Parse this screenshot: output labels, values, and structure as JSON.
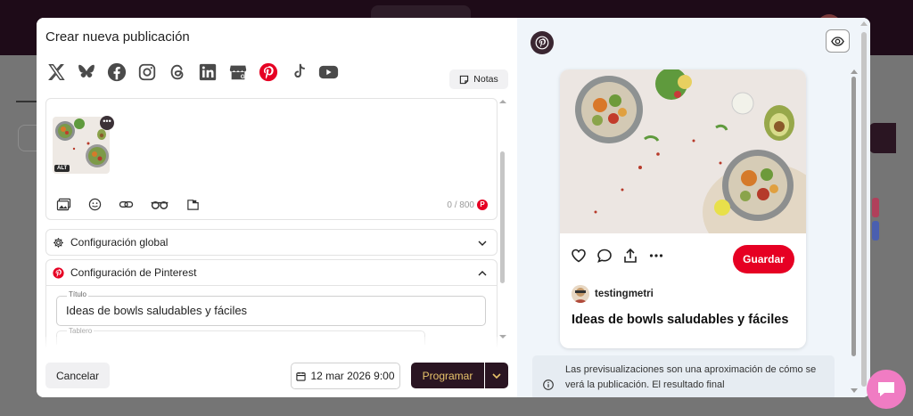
{
  "modal": {
    "title": "Crear nueva publicación",
    "notes_label": "Notas",
    "social_networks": [
      "x-icon",
      "bluesky-icon",
      "facebook-icon",
      "instagram-icon",
      "threads-icon",
      "linkedin-icon",
      "google-business-icon",
      "pinterest-icon",
      "tiktok-icon",
      "youtube-icon"
    ],
    "selected_network": "pinterest-icon",
    "editor": {
      "alt_badge": "ALT",
      "char_counter": "0 / 800",
      "tools": [
        "media-icon",
        "emoji-icon",
        "link-icon",
        "glasses-icon",
        "folder-icon"
      ]
    },
    "accordions": {
      "global": "Configuración global",
      "pinterest": "Configuración de Pinterest"
    },
    "pinterest_settings": {
      "title_label": "Título",
      "title_value": "Ideas de bowls saludables y fáciles",
      "board_label": "Tablero"
    },
    "footer": {
      "cancel_label": "Cancelar",
      "date_value": "12 mar 2026 9:00",
      "schedule_label": "Programar"
    }
  },
  "preview": {
    "username": "testingmetri",
    "pin_title": "Ideas de bowls saludables y fáciles",
    "save_label": "Guardar",
    "notice_text": "Las previsualizaciones son una aproximación de cómo se verá la publicación. El resultado final"
  },
  "colors": {
    "brand_dark": "#2a1522",
    "brand_gold": "#e8c36a",
    "pinterest_red": "#e60023",
    "chat_pink": "#f07cc3"
  }
}
